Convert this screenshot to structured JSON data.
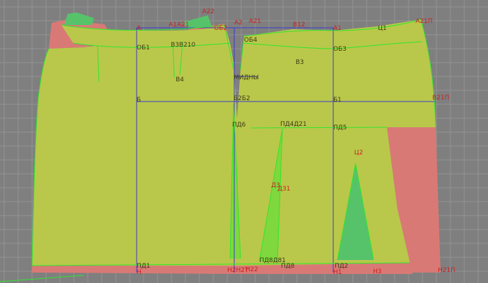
{
  "colors": {
    "background": "#7f7f7f",
    "grid": "#939393",
    "panel_fill": "#b9c84a",
    "overlap_fill": "#d97975",
    "dart_fill": "#56c36b",
    "dart_fill_light": "#7fd83d",
    "outline_green": "#2ee62e",
    "outline_blue": "#3a3ad0",
    "label_red": "#cc1f1f",
    "label_dark": "#3d3a12"
  },
  "labels": {
    "a22": "А22",
    "a2": "А2",
    "a21_top": "А21",
    "b12": "В12",
    "a1_top": "А1",
    "a21p": "А21П",
    "a": "А",
    "a1a21": "А1А21",
    "ob2": "ОБ2",
    "c1": "Ц1",
    "ob1": "ОБ1",
    "b3b210": "В3В210",
    "ob4": "ОБ4",
    "ob3": "ОБ3",
    "b3": "В3",
    "b4": "В4",
    "mid_hip": "МИДНЫ",
    "b21p": "В21П",
    "b": "Б",
    "b2b22": "Б2Б2",
    "b1": "Б1",
    "pd6": "ПД6",
    "pd4d21": "ПД4Д21",
    "pd5": "ПД5",
    "c2": "Ц2",
    "d3": "Д3",
    "d31": "Д31",
    "pd1": "ПД1",
    "pd8d81": "ПД8Д81",
    "pd2": "ПД2",
    "pd8": "ПД8",
    "n2n21": "Н2Н2Т",
    "n22": "Н22",
    "n1": "Н1",
    "n3": "Н3",
    "n21p": "Н21П",
    "n": "Н"
  }
}
